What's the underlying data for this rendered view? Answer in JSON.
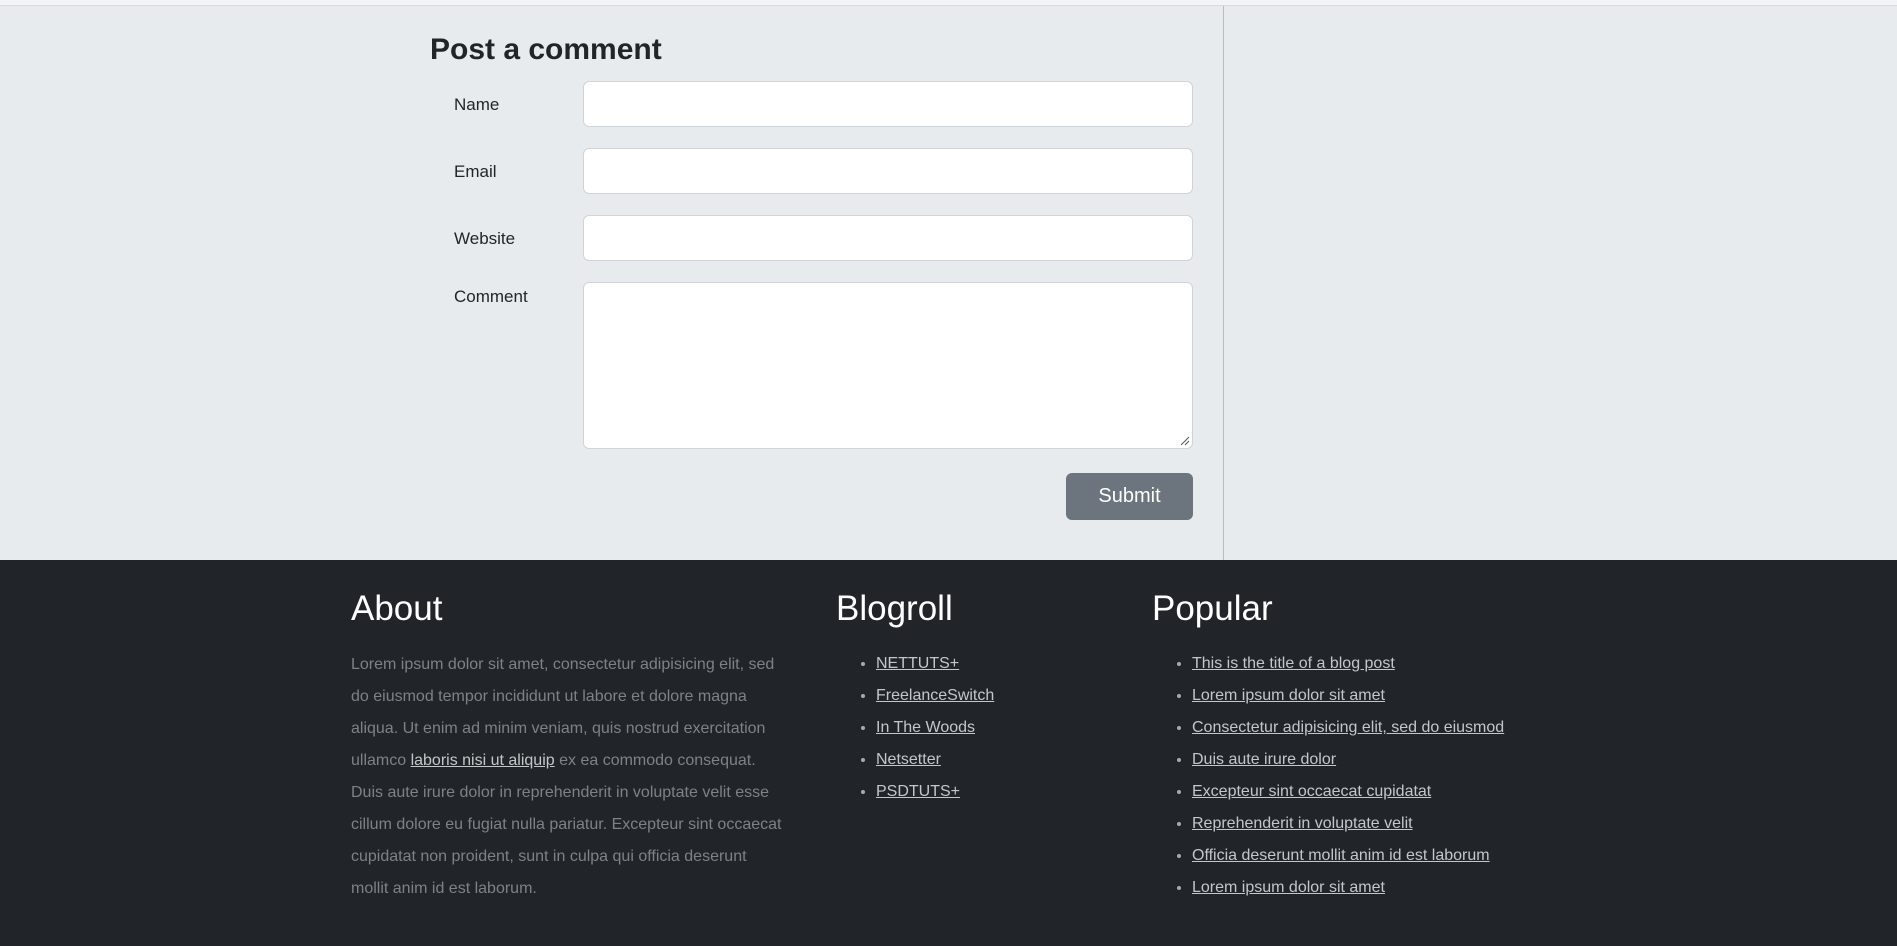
{
  "comment_form": {
    "title": "Post a comment",
    "fields": {
      "name": {
        "label": "Name",
        "value": "",
        "placeholder": ""
      },
      "email": {
        "label": "Email",
        "value": "",
        "placeholder": ""
      },
      "website": {
        "label": "Website",
        "value": "",
        "placeholder": ""
      },
      "comment": {
        "label": "Comment",
        "value": "",
        "placeholder": ""
      }
    },
    "submit_label": "Submit"
  },
  "footer": {
    "about": {
      "heading": "About",
      "text_before": "Lorem ipsum dolor sit amet, consectetur adipisicing elit, sed do eiusmod tempor incididunt ut labore et dolore magna aliqua. Ut enim ad minim veniam, quis nostrud exercitation ullamco ",
      "link": "laboris nisi ut aliquip",
      "text_after": " ex ea commodo consequat. Duis aute irure dolor in reprehenderit in voluptate velit esse cillum dolore eu fugiat nulla pariatur. Excepteur sint occaecat cupidatat non proident, sunt in culpa qui officia deserunt mollit anim id est laborum."
    },
    "blogroll": {
      "heading": "Blogroll",
      "links": [
        "NETTUTS+",
        "FreelanceSwitch",
        "In The Woods",
        "Netsetter",
        "PSDTUTS+"
      ]
    },
    "popular": {
      "heading": "Popular",
      "links": [
        "This is the title of a blog post",
        "Lorem ipsum dolor sit amet",
        "Consectetur adipisicing elit, sed do eiusmod",
        "Duis aute irure dolor",
        "Excepteur sint occaecat cupidatat",
        "Reprehenderit in voluptate velit",
        "Officia deserunt mollit anim id est laborum",
        "Lorem ipsum dolor sit amet"
      ]
    }
  },
  "colors": {
    "content_bg": "#e8ebee",
    "footer_bg": "#212529",
    "button_bg": "#6c757d"
  }
}
